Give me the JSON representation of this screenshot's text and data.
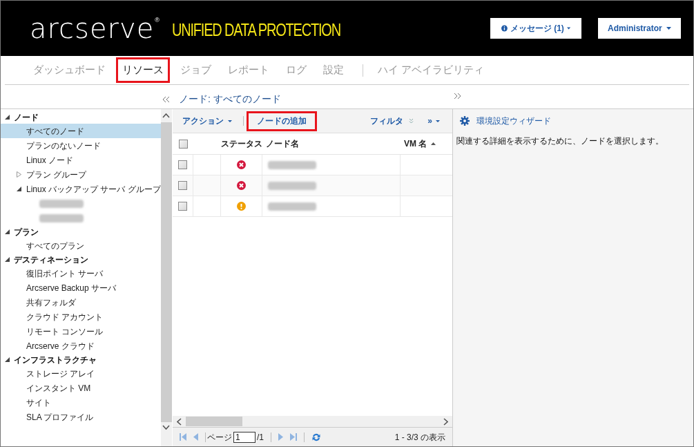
{
  "header": {
    "logo": "arcserve",
    "logo_mark": "®",
    "product": "UNIFIED DATA PROTECTION",
    "messages_button": "メッセージ (1)",
    "user_button": "Administrator"
  },
  "nav": [
    {
      "label": "ダッシュボード",
      "selected": false,
      "highlighted": false
    },
    {
      "label": "リソース",
      "selected": true,
      "highlighted": true
    },
    {
      "label": "ジョブ",
      "selected": false,
      "highlighted": false
    },
    {
      "label": "レポート",
      "selected": false,
      "highlighted": false
    },
    {
      "label": "ログ",
      "selected": false,
      "highlighted": false
    },
    {
      "label": "設定",
      "selected": false,
      "highlighted": false
    },
    {
      "label": "ハイ アベイラビリティ",
      "selected": false,
      "highlighted": false
    }
  ],
  "panel_title": "ノード: すべてのノード",
  "tree": [
    {
      "label": "ノード",
      "expanded": true,
      "children": [
        {
          "label": "すべてのノード",
          "selected": true
        },
        {
          "label": "プランのないノード",
          "selected": false
        },
        {
          "label": "Linux ノード",
          "selected": false
        },
        {
          "label": "プラン グループ",
          "selected": false,
          "expanded": false
        },
        {
          "label": "Linux バックアップ サーバ グループ",
          "selected": false,
          "expanded": true,
          "children": [
            {
              "redacted": true
            },
            {
              "redacted": true
            }
          ]
        }
      ]
    },
    {
      "label": "プラン",
      "expanded": true,
      "children": [
        {
          "label": "すべてのプラン",
          "selected": false
        }
      ]
    },
    {
      "label": "デスティネーション",
      "expanded": true,
      "children": [
        {
          "label": "復旧ポイント サーバ",
          "selected": false
        },
        {
          "label": "Arcserve Backup サーバ",
          "selected": false
        },
        {
          "label": "共有フォルダ",
          "selected": false
        },
        {
          "label": "クラウド アカウント",
          "selected": false
        },
        {
          "label": "リモート コンソール",
          "selected": false
        },
        {
          "label": "Arcserve クラウド",
          "selected": false
        }
      ]
    },
    {
      "label": "インフラストラクチャ",
      "expanded": true,
      "children": [
        {
          "label": "ストレージ アレイ",
          "selected": false
        },
        {
          "label": "インスタント VM",
          "selected": false
        },
        {
          "label": "サイト",
          "selected": false
        },
        {
          "label": "SLA プロファイル",
          "selected": false
        }
      ]
    }
  ],
  "toolbar": {
    "actions": "アクション",
    "add_node": {
      "label": "ノードの追加",
      "highlighted": true
    },
    "filter": "フィルタ",
    "more": "»"
  },
  "table": {
    "columns": [
      "ステータス",
      "ノード名",
      "VM 名"
    ],
    "all_checked": false,
    "rows": [
      {
        "checked": false,
        "kind": "error",
        "name_redacted": true
      },
      {
        "checked": false,
        "kind": "error",
        "name_redacted": true
      },
      {
        "checked": false,
        "kind": "warning",
        "name_redacted": true
      }
    ]
  },
  "pager": {
    "page_label": "ページ",
    "page": "1",
    "total": "/1",
    "summary": "1 - 3/3 の表示"
  },
  "details": {
    "wizard_link": "環境設定ウィザード",
    "message": "関連する詳細を表示するために、ノードを選択します。"
  }
}
